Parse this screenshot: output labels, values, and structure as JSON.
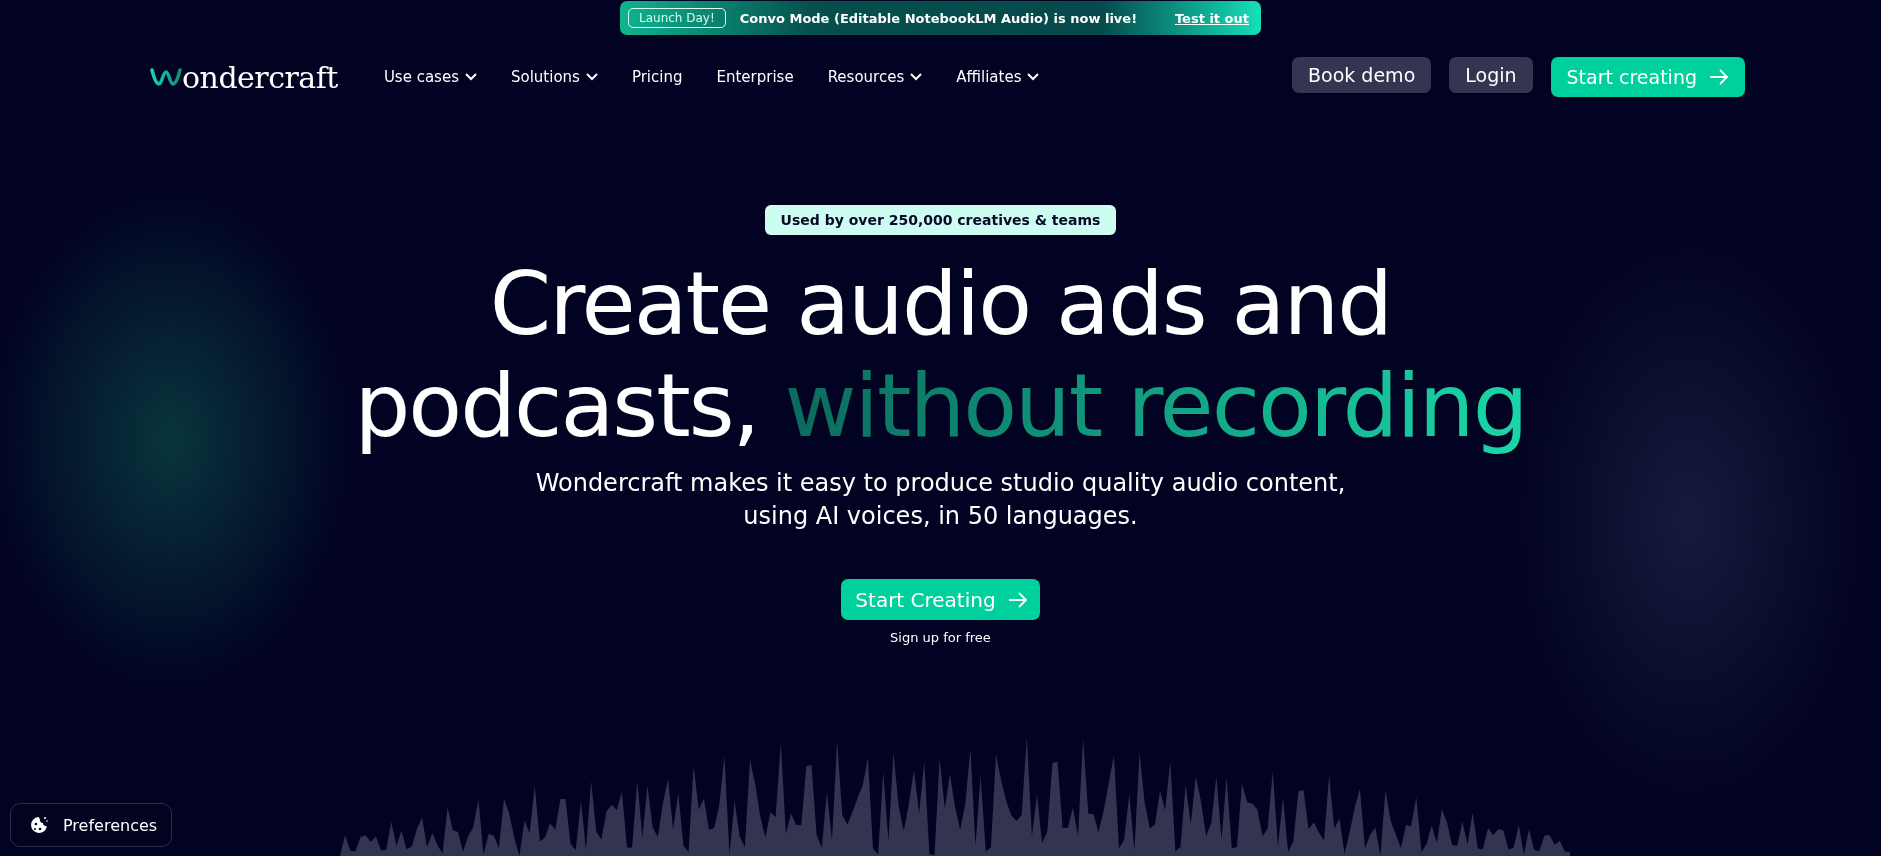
{
  "announcement": {
    "badge": "Launch Day!",
    "message": "Convo Mode (Editable NotebookLM Audio) is now live!",
    "link": "Test it out"
  },
  "logo": {
    "text": "ondercraft"
  },
  "nav": [
    {
      "label": "Use cases",
      "dropdown": true
    },
    {
      "label": "Solutions",
      "dropdown": true
    },
    {
      "label": "Pricing",
      "dropdown": false
    },
    {
      "label": "Enterprise",
      "dropdown": false
    },
    {
      "label": "Resources",
      "dropdown": true
    },
    {
      "label": "Affiliates",
      "dropdown": true
    }
  ],
  "actions": [
    {
      "label": "Book demo",
      "kind": "secondary"
    },
    {
      "label": "Login",
      "kind": "secondary"
    },
    {
      "label": "Start creating",
      "kind": "primary"
    }
  ],
  "hero": {
    "badge": "Used by over 250,000 creatives & teams",
    "title_line_1": "Create audio ads and",
    "title_line_2": "podcasts,",
    "title_highlight": "without recording",
    "subtitle_line_1": "Wondercraft makes it easy to produce studio quality audio content,",
    "subtitle_line_2": "using AI voices, in 50 languages.",
    "cta": "Start Creating",
    "cta_note": "Sign up for free"
  },
  "preferences": {
    "label": "Preferences"
  }
}
